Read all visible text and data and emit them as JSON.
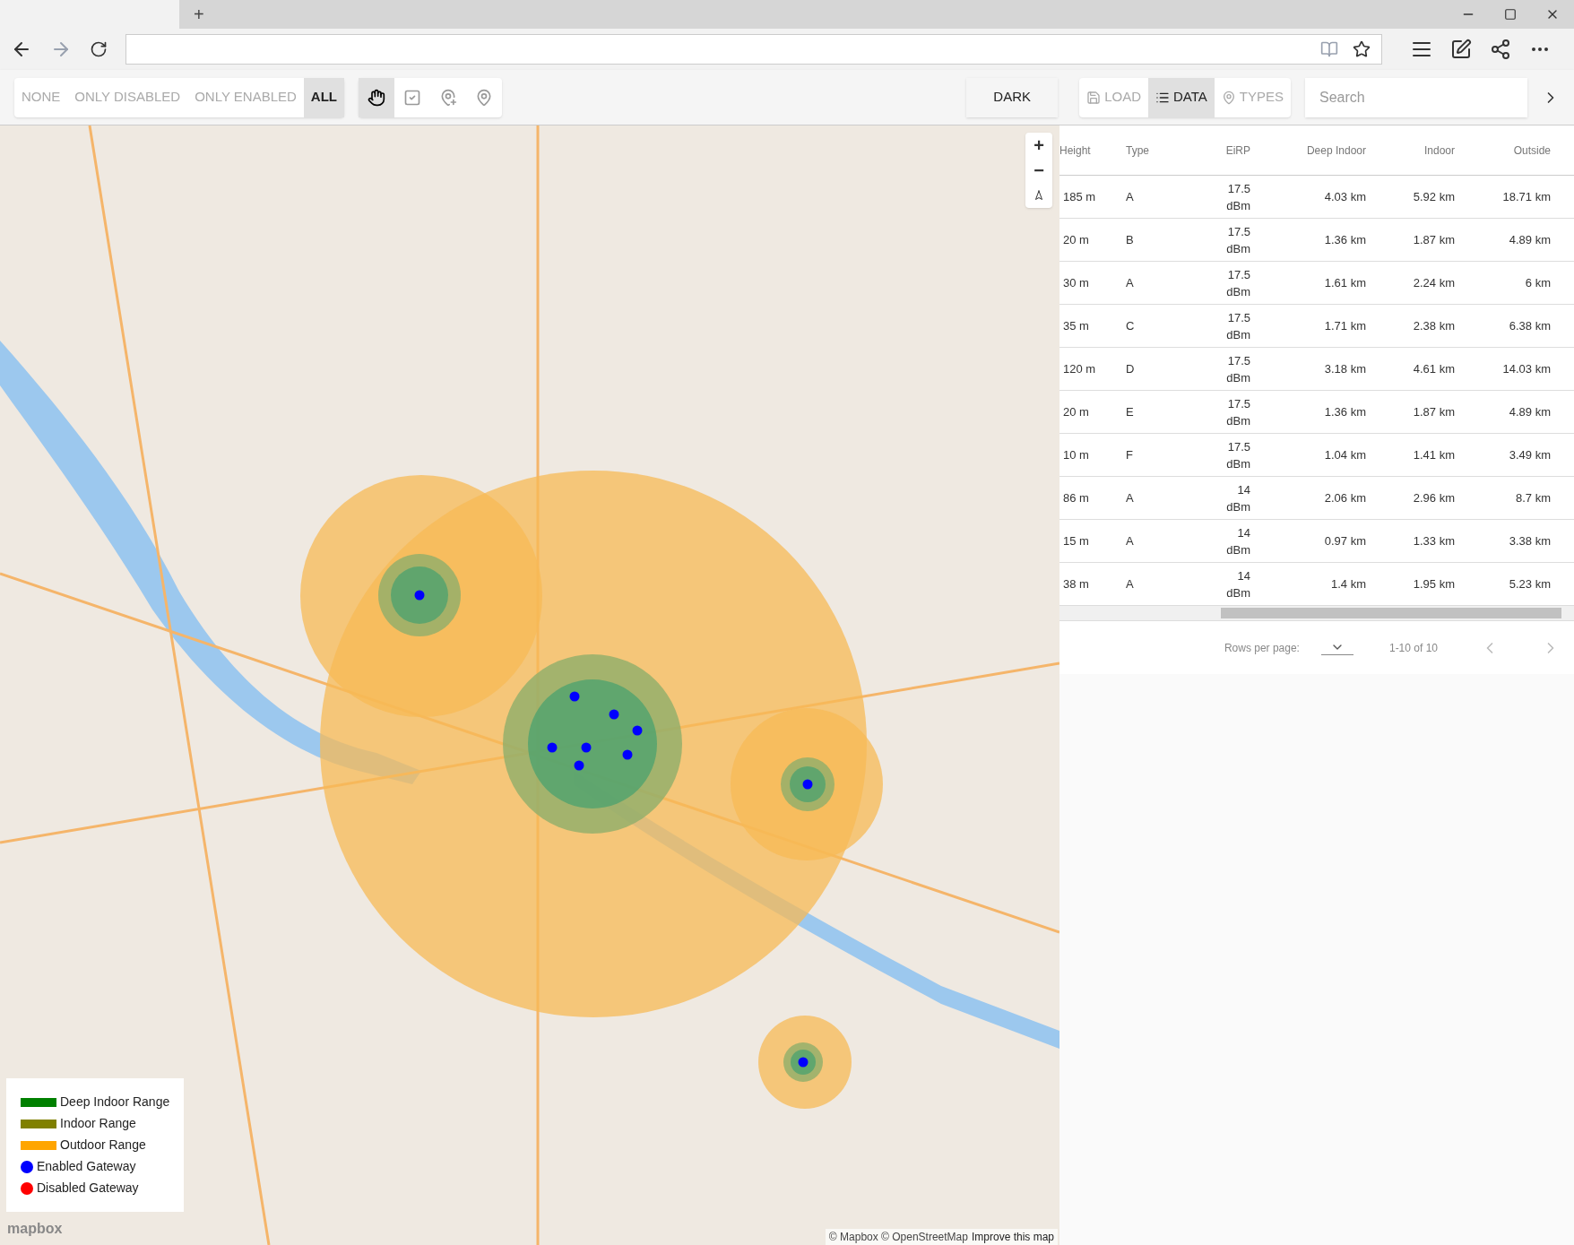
{
  "browser": {
    "new_tab": "+"
  },
  "filters": [
    {
      "label": "NONE",
      "selected": false
    },
    {
      "label": "ONLY DISABLED",
      "selected": false
    },
    {
      "label": "ONLY ENABLED",
      "selected": false
    },
    {
      "label": "ALL",
      "selected": true
    }
  ],
  "tools": [
    {
      "kind": "hand",
      "selected": true
    },
    {
      "kind": "check",
      "selected": false
    },
    {
      "kind": "pin-plus",
      "selected": false
    },
    {
      "kind": "pin",
      "selected": false
    }
  ],
  "dark_button": "DARK",
  "views": [
    {
      "kind": "save",
      "label": "LOAD",
      "selected": false
    },
    {
      "kind": "list",
      "label": "DATA",
      "selected": true
    },
    {
      "kind": "pin",
      "label": "TYPES",
      "selected": false
    }
  ],
  "search": {
    "placeholder": "Search"
  },
  "map": {
    "zoom_in": "+",
    "zoom_out": "−",
    "legend": [
      {
        "kind": "bar",
        "label": "Deep Indoor Range",
        "color": "#008000"
      },
      {
        "kind": "bar",
        "label": "Indoor Range",
        "color": "#808000"
      },
      {
        "kind": "bar",
        "label": "Outdoor Range",
        "color": "#ffa500"
      },
      {
        "kind": "dot",
        "label": "Enabled Gateway",
        "color": "#0000ff"
      },
      {
        "kind": "dot",
        "label": "Disabled Gateway",
        "color": "#ff0000"
      }
    ],
    "logo": "mapbox",
    "attribution": "© Mapbox © OpenStreetMap",
    "improve_link": "Improve this map"
  },
  "table": {
    "columns": [
      "Height",
      "Type",
      "EiRP",
      "Deep Indoor",
      "Indoor",
      "Outside"
    ],
    "rows": [
      [
        "185 m",
        "A",
        "17.5 dBm",
        "4.03 km",
        "5.92 km",
        "18.71 km"
      ],
      [
        "20 m",
        "B",
        "17.5 dBm",
        "1.36 km",
        "1.87 km",
        "4.89 km"
      ],
      [
        "30 m",
        "A",
        "17.5 dBm",
        "1.61 km",
        "2.24 km",
        "6 km"
      ],
      [
        "35 m",
        "C",
        "17.5 dBm",
        "1.71 km",
        "2.38 km",
        "6.38 km"
      ],
      [
        "120 m",
        "D",
        "17.5 dBm",
        "3.18 km",
        "4.61 km",
        "14.03 km"
      ],
      [
        "20 m",
        "E",
        "17.5 dBm",
        "1.36 km",
        "1.87 km",
        "4.89 km"
      ],
      [
        "10 m",
        "F",
        "17.5 dBm",
        "1.04 km",
        "1.41 km",
        "3.49 km"
      ],
      [
        "86 m",
        "A",
        "14 dBm",
        "2.06 km",
        "2.96 km",
        "8.7 km"
      ],
      [
        "15 m",
        "A",
        "14 dBm",
        "0.97 km",
        "1.33 km",
        "3.38 km"
      ],
      [
        "38 m",
        "A",
        "14 dBm",
        "1.4 km",
        "1.95 km",
        "5.23 km"
      ]
    ],
    "rows_per_page": "Rows per page:",
    "range": "1-10 of 10"
  }
}
